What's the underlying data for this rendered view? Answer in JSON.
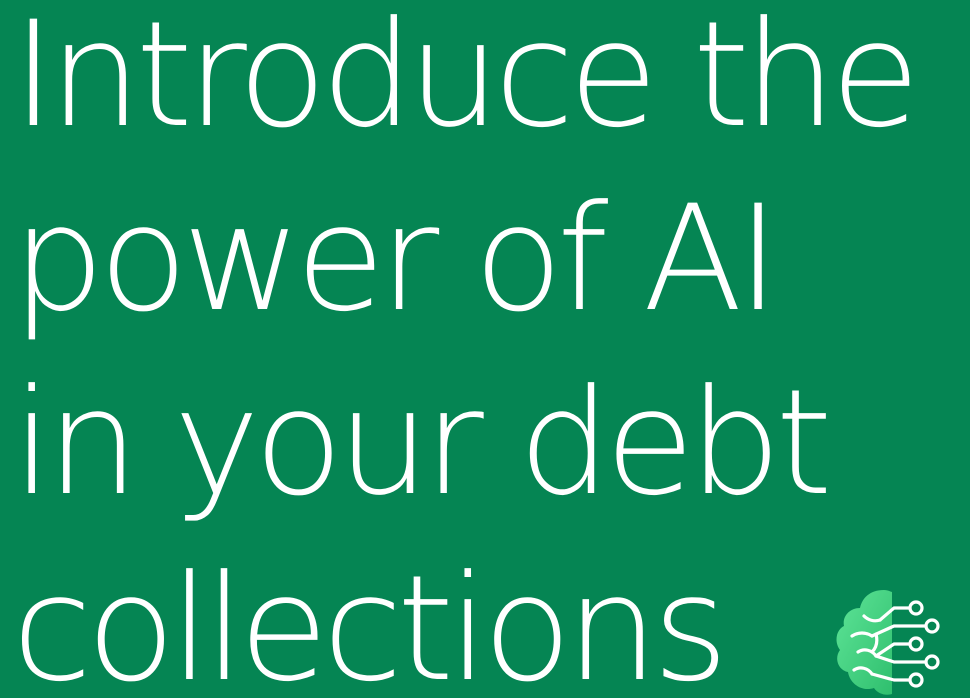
{
  "headline": {
    "lines": [
      "Introduce the",
      "power of AI",
      "in your debt",
      "collections"
    ]
  },
  "icon": {
    "name": "ai-brain-circuit-icon",
    "colors": {
      "fill_light": "#52d98a",
      "fill_dark": "#2fbf6e",
      "stroke": "#ffffff"
    }
  },
  "colors": {
    "background": "#058553",
    "text": "#ffffff"
  }
}
